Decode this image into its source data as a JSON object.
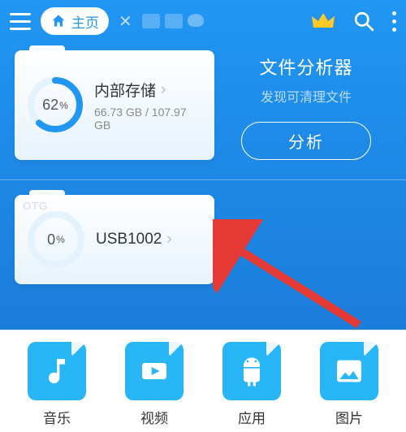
{
  "topbar": {
    "home_label": "主页"
  },
  "storage": {
    "internal": {
      "title": "内部存储",
      "usage_text": "66.73 GB / 107.97 GB",
      "percent_label": "62",
      "percent_suffix": "%"
    },
    "otg": {
      "badge": "OTG",
      "title": "USB1002",
      "percent_label": "0",
      "percent_suffix": "%"
    }
  },
  "analyzer": {
    "title": "文件分析器",
    "subtitle": "发现可清理文件",
    "button": "分析"
  },
  "tray": {
    "music": "音乐",
    "video": "视频",
    "apps": "应用",
    "images": "图片"
  }
}
